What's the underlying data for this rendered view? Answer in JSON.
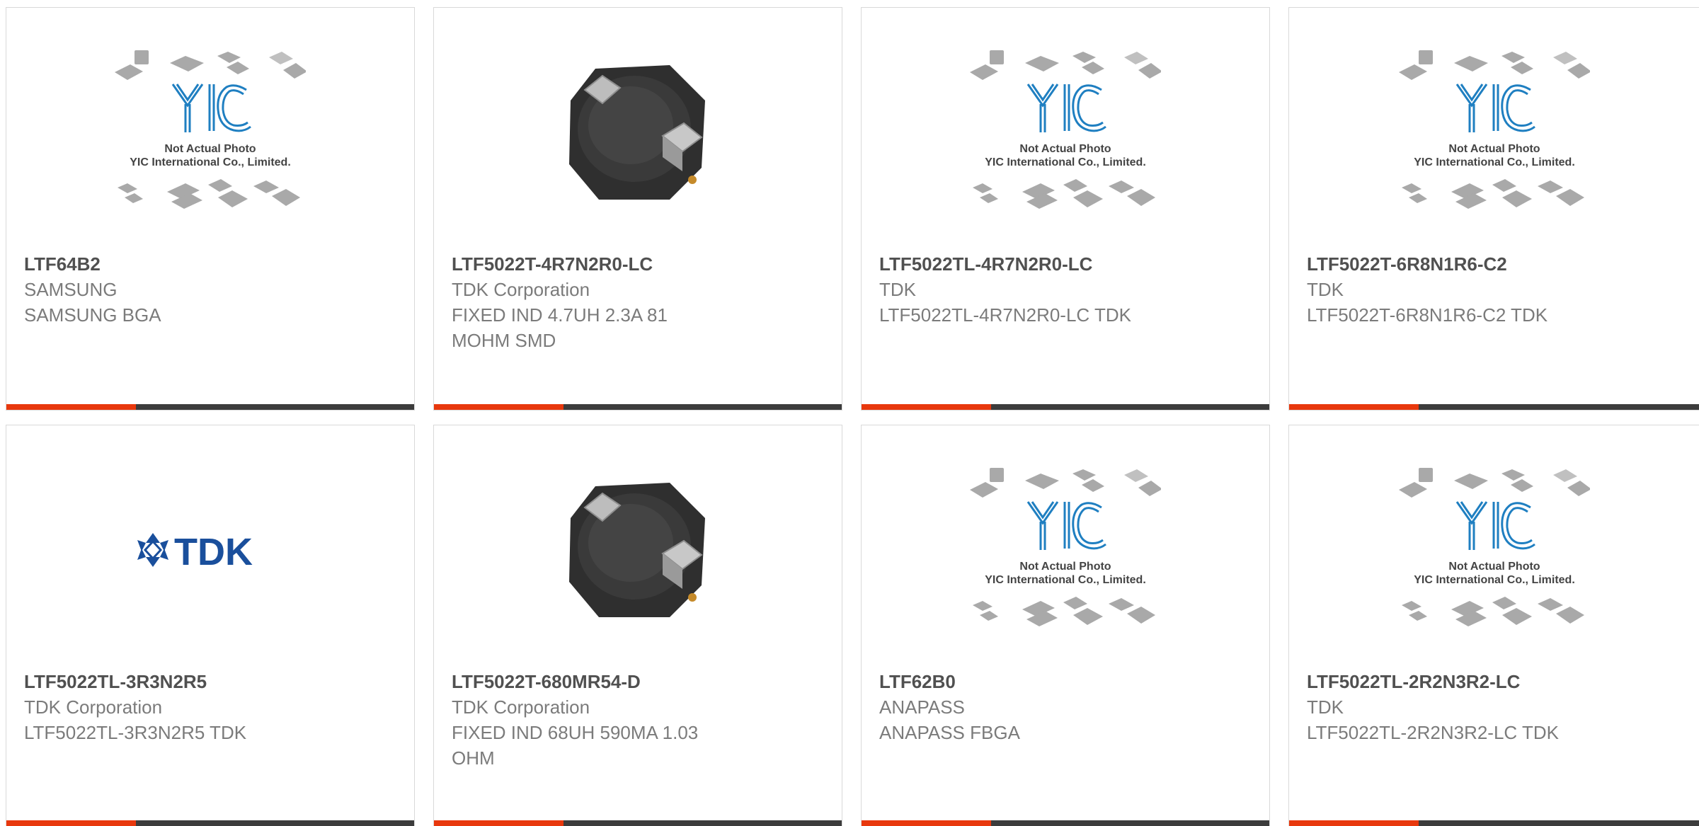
{
  "colors": {
    "accent": "#e8380d",
    "bar": "#3c3c3c",
    "border": "#d9d9d9",
    "title": "#505050",
    "text": "#7b7b7b",
    "yic_blue": "#1f7fc1",
    "tdk_blue": "#1a4f9c"
  },
  "placeholder": {
    "brand": "YIC",
    "line1": "Not Actual Photo",
    "line2": "YIC International Co., Limited."
  },
  "products": [
    {
      "image": "yic-placeholder",
      "part": "LTF64B2",
      "maker": "SAMSUNG",
      "desc1": "SAMSUNG BGA",
      "desc2": ""
    },
    {
      "image": "inductor-photo",
      "part": "LTF5022T-4R7N2R0-LC",
      "maker": "TDK Corporation",
      "desc1": "FIXED IND 4.7UH 2.3A 81",
      "desc2": "MOHM SMD"
    },
    {
      "image": "yic-placeholder",
      "part": "LTF5022TL-4R7N2R0-LC",
      "maker": "TDK",
      "desc1": "LTF5022TL-4R7N2R0-LC TDK",
      "desc2": ""
    },
    {
      "image": "yic-placeholder",
      "part": "LTF5022T-6R8N1R6-C2",
      "maker": "TDK",
      "desc1": "LTF5022T-6R8N1R6-C2 TDK",
      "desc2": ""
    },
    {
      "image": "tdk-logo",
      "logo_text": "TDK",
      "part": "LTF5022TL-3R3N2R5",
      "maker": "TDK Corporation",
      "desc1": "LTF5022TL-3R3N2R5 TDK",
      "desc2": ""
    },
    {
      "image": "inductor-photo",
      "part": "LTF5022T-680MR54-D",
      "maker": "TDK Corporation",
      "desc1": "FIXED IND 68UH 590MA 1.03",
      "desc2": "OHM"
    },
    {
      "image": "yic-placeholder",
      "part": "LTF62B0",
      "maker": "ANAPASS",
      "desc1": "ANAPASS FBGA",
      "desc2": ""
    },
    {
      "image": "yic-placeholder",
      "part": "LTF5022TL-2R2N3R2-LC",
      "maker": "TDK",
      "desc1": "LTF5022TL-2R2N3R2-LC TDK",
      "desc2": ""
    }
  ]
}
